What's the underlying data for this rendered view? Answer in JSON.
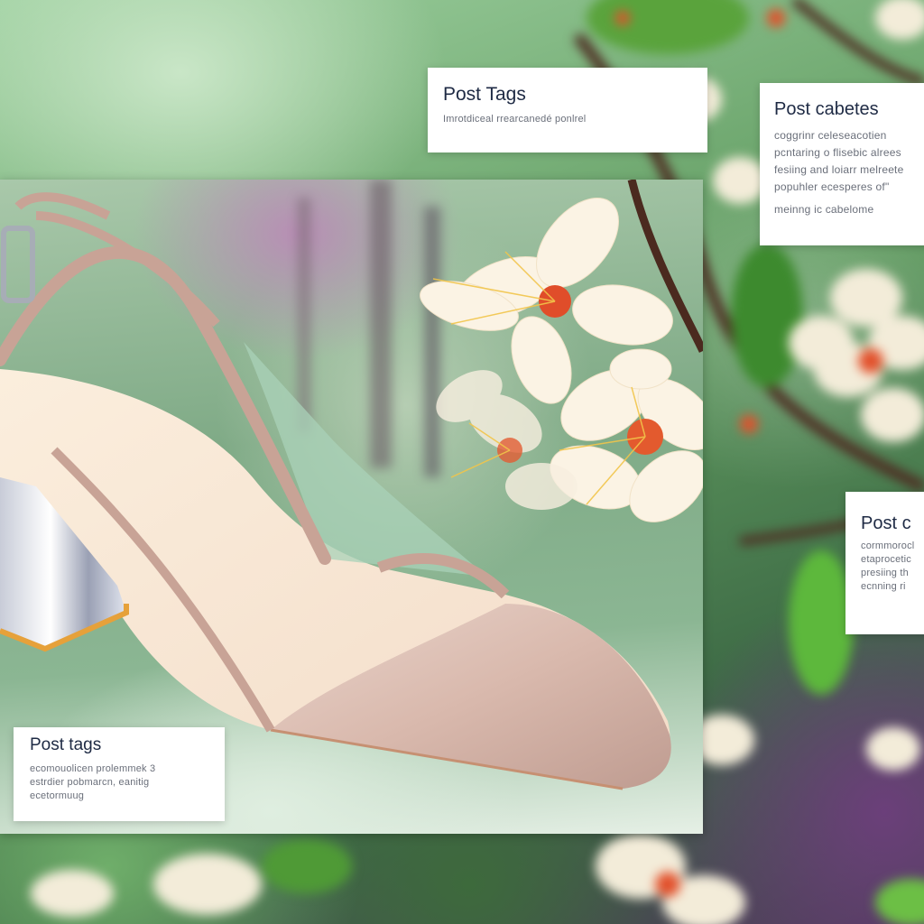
{
  "cards": {
    "top": {
      "title": "Post Tags",
      "lines": [
        "Imrotdiceal rrearcanedé ponlrel"
      ]
    },
    "right": {
      "title": "Post cabetes",
      "lines": [
        "coggrinr celeseacotien",
        "pcntaring o flisebic alrees",
        "fesiing and loiarr melreete",
        "popuhler ecesperes of\"",
        "meinng ic cabelome"
      ]
    },
    "middle": {
      "title": "Post c",
      "lines": [
        "cormmorocl",
        "etaprocetic",
        "presiing th",
        "ecnning ri"
      ]
    },
    "bottom": {
      "title": "Post tags",
      "lines": [
        "ecomouolicen prolemmek 3",
        "estrdier pobmarcn, eanitig",
        "ecetormuug"
      ]
    }
  }
}
